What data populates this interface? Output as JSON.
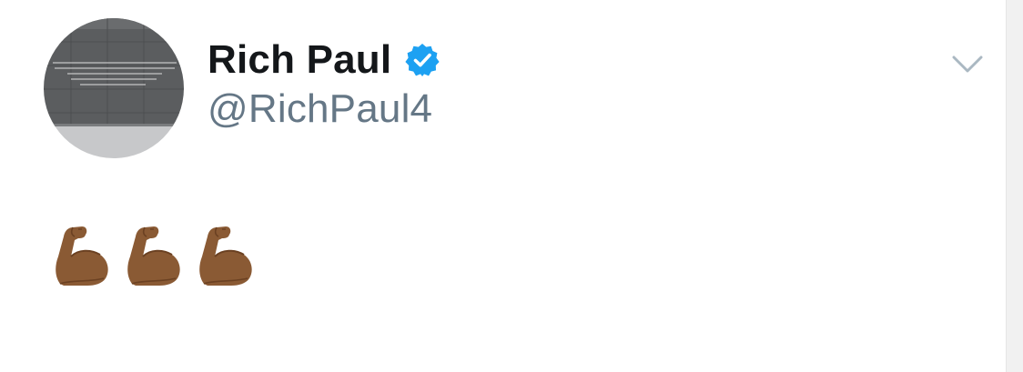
{
  "tweet": {
    "author": {
      "display_name": "Rich Paul",
      "handle": "@RichPaul4",
      "verified": true
    },
    "body": {
      "emojis": [
        "flexed-biceps",
        "flexed-biceps",
        "flexed-biceps"
      ]
    },
    "menu_icon": "chevron-down-icon",
    "verified_icon": "verified-badge-icon"
  },
  "colors": {
    "name": "#14171a",
    "handle": "#657786",
    "verified": "#1da1f2",
    "chevron": "#aab8c2",
    "emoji_skin": "#8a5a34"
  }
}
